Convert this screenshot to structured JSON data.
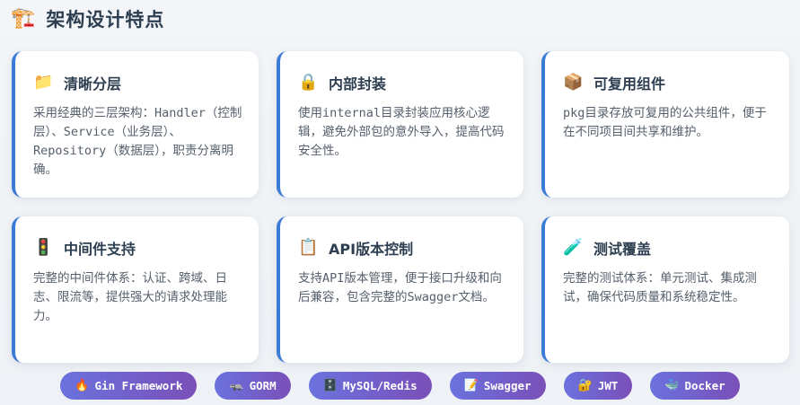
{
  "header": {
    "icon": "🏗️",
    "title": "架构设计特点"
  },
  "cards": [
    {
      "icon": "📁",
      "title": "清晰分层",
      "desc": "采用经典的三层架构：Handler（控制层）、Service（业务层）、Repository（数据层），职责分离明确。"
    },
    {
      "icon": "🔒",
      "title": "内部封装",
      "desc": "使用internal目录封装应用核心逻辑，避免外部包的意外导入，提高代码安全性。"
    },
    {
      "icon": "📦",
      "title": "可复用组件",
      "desc": "pkg目录存放可复用的公共组件，便于在不同项目间共享和维护。"
    },
    {
      "icon": "🚦",
      "title": "中间件支持",
      "desc": "完整的中间件体系：认证、跨域、日志、限流等，提供强大的请求处理能力。"
    },
    {
      "icon": "📋",
      "title": "API版本控制",
      "desc": "支持API版本管理，便于接口升级和向后兼容，包含完整的Swagger文档。"
    },
    {
      "icon": "🧪",
      "title": "测试覆盖",
      "desc": "完整的测试体系：单元测试、集成测试，确保代码质量和系统稳定性。"
    }
  ],
  "tags": [
    {
      "icon": "🔥",
      "label": "Gin Framework"
    },
    {
      "icon": "🦡",
      "label": "GORM"
    },
    {
      "icon": "🗄️",
      "label": "MySQL/Redis"
    },
    {
      "icon": "📝",
      "label": "Swagger"
    },
    {
      "icon": "🔐",
      "label": "JWT"
    },
    {
      "icon": "🐳",
      "label": "Docker"
    }
  ],
  "colors": {
    "accent": "#3a7bd5",
    "tag_start": "#6b72de",
    "tag_end": "#7a4fb8"
  }
}
